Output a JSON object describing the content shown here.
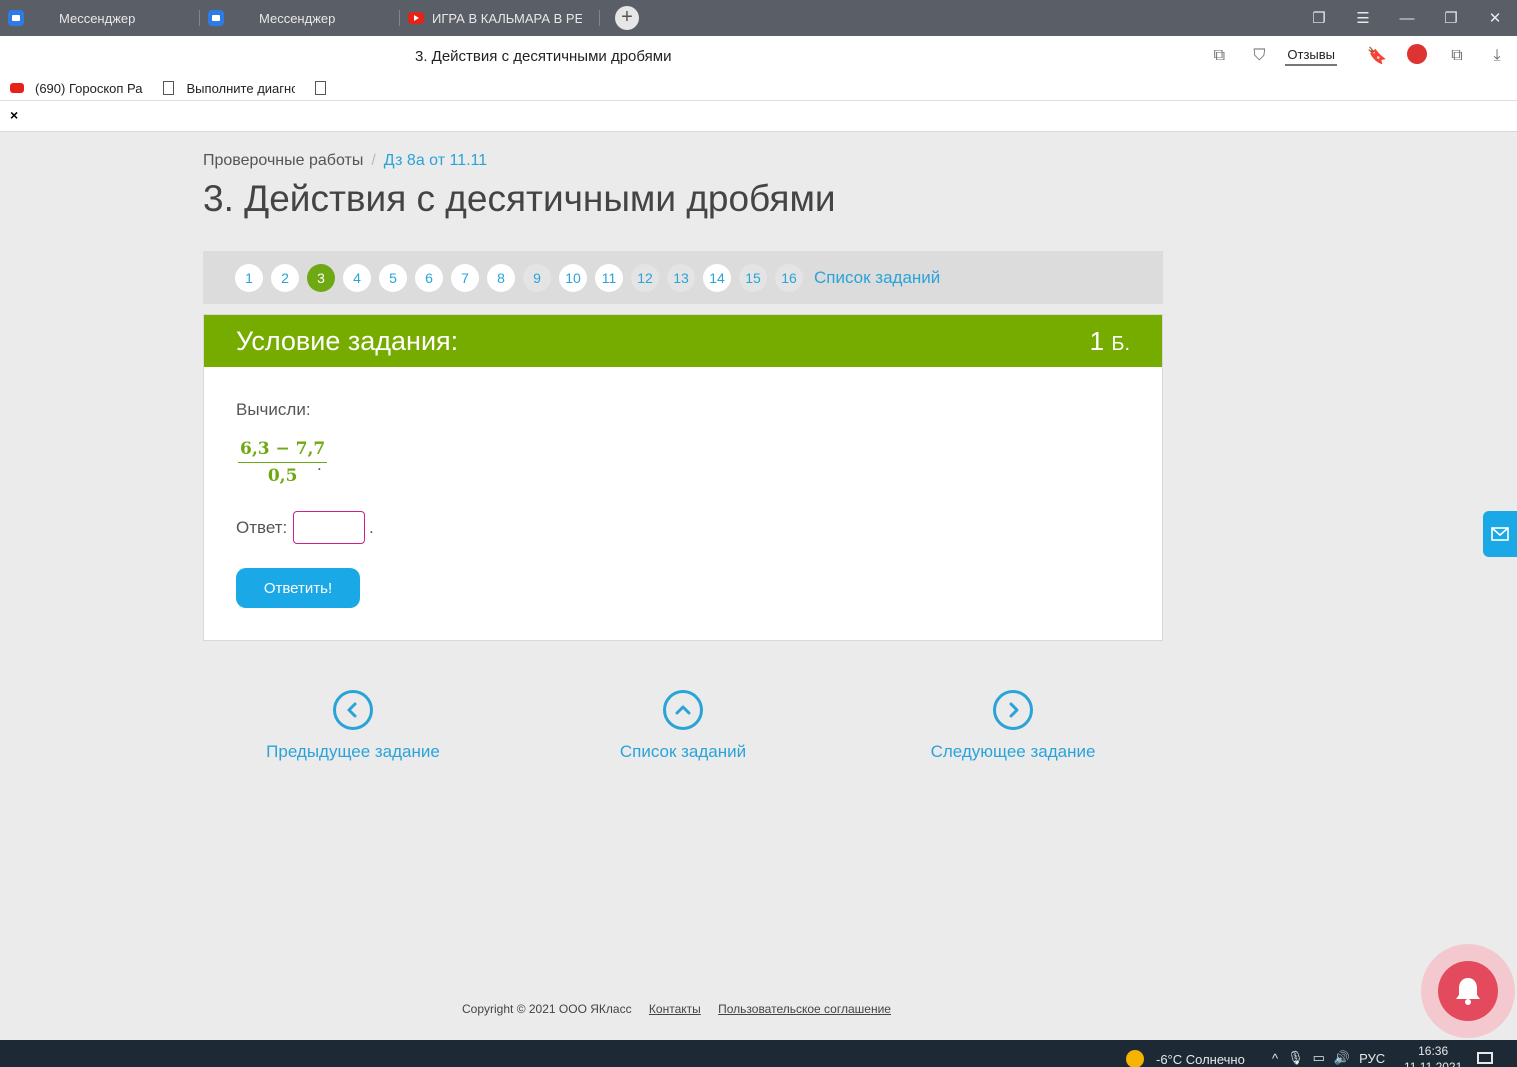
{
  "browser": {
    "tabs": [
      {
        "title": "Мессенджер",
        "icon": "messenger-icon"
      },
      {
        "title": "Мессенджер",
        "icon": "messenger-icon"
      },
      {
        "title": "ИГРА В КАЛЬМАРА В РЕАЛ",
        "icon": "youtube-icon"
      }
    ],
    "page_title": "3. Действия с десятичными дробями",
    "feedback_label": "Отзывы",
    "bookmarks": [
      {
        "label": "(690) Гороскоп Ра",
        "icon": "youtube-icon"
      },
      {
        "label": "Выполните диагно",
        "icon": "document-icon"
      }
    ],
    "close_label": "×"
  },
  "breadcrumb": {
    "parent": "Проверочные работы",
    "separator": "/",
    "current": "Дз 8а от 11.11"
  },
  "title": "3. Действия с десятичными дробями",
  "task_nav": {
    "numbers": [
      "1",
      "2",
      "3",
      "4",
      "5",
      "6",
      "7",
      "8",
      "9",
      "10",
      "11",
      "12",
      "13",
      "14",
      "15",
      "16"
    ],
    "active": "3",
    "list_label": "Список заданий"
  },
  "task": {
    "header": "Условие задания:",
    "points": "1",
    "points_unit": "Б.",
    "instruction": "Вычисли:",
    "fraction_numerator": "6,3 − 7,7",
    "fraction_denominator": "0,5",
    "fraction_end": ".",
    "answer_label": "Ответ:",
    "answer_value": "",
    "answer_end": ".",
    "submit_label": "Ответить!"
  },
  "pager": {
    "prev_label": "Предыдущее задание",
    "list_label": "Список заданий",
    "next_label": "Следующее задание"
  },
  "footer": {
    "copyright": "Copyright © 2021 ООО ЯКласс",
    "contacts": "Контакты",
    "agreement": "Пользовательское соглашение"
  },
  "taskbar": {
    "weather": "-6°C  Солнечно",
    "lang": "РУС",
    "time": "16:36",
    "date": "11.11.2021"
  },
  "colors": {
    "accent_green": "#76ab00",
    "link_blue": "#2aa3d9",
    "button_blue": "#1aa8e6",
    "input_border": "#d21e8a"
  }
}
